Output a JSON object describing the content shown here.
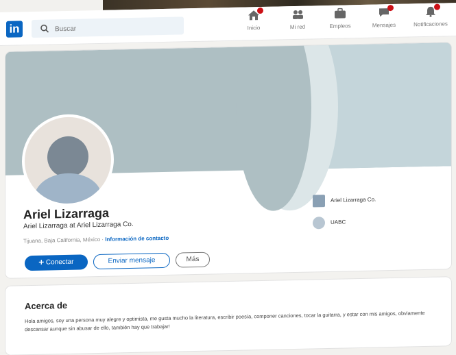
{
  "nav": {
    "logo": "in",
    "search_placeholder": "Buscar",
    "items": [
      {
        "label": "Inicio",
        "icon": "home-icon",
        "badge": true
      },
      {
        "label": "Mi red",
        "icon": "network-icon",
        "badge": false
      },
      {
        "label": "Empleos",
        "icon": "briefcase-icon",
        "badge": false
      },
      {
        "label": "Mensajes",
        "icon": "message-icon",
        "badge": true
      },
      {
        "label": "Notificaciones",
        "icon": "bell-icon",
        "badge": true
      }
    ]
  },
  "profile": {
    "name": "Ariel Lizarraga",
    "headline": "Ariel Lizarraga at Ariel Lizarraga Co.",
    "location": "Tijuana, Baja California, México",
    "separator": " · ",
    "contact_link": "Información de contacto",
    "connect_label": "Conectar",
    "message_label": "Enviar mensaje",
    "more_label": "Más",
    "experience": [
      {
        "label": "Ariel Lizarraga Co.",
        "icon": "company-icon"
      },
      {
        "label": "UABC",
        "icon": "school-icon"
      }
    ]
  },
  "about": {
    "title": "Acerca de",
    "text": "Hola amigos, soy una persona muy alegre y optimista, me gusta mucho la literatura, escribir poesía, componer canciones, tocar la guitarra, y estar con mis amigos, obviamente descansar aunque sin abusar de ello, también hay que trabajar!"
  },
  "colors": {
    "brand": "#0a66c2",
    "badge": "#cc1016",
    "banner": "#aebfc3"
  }
}
